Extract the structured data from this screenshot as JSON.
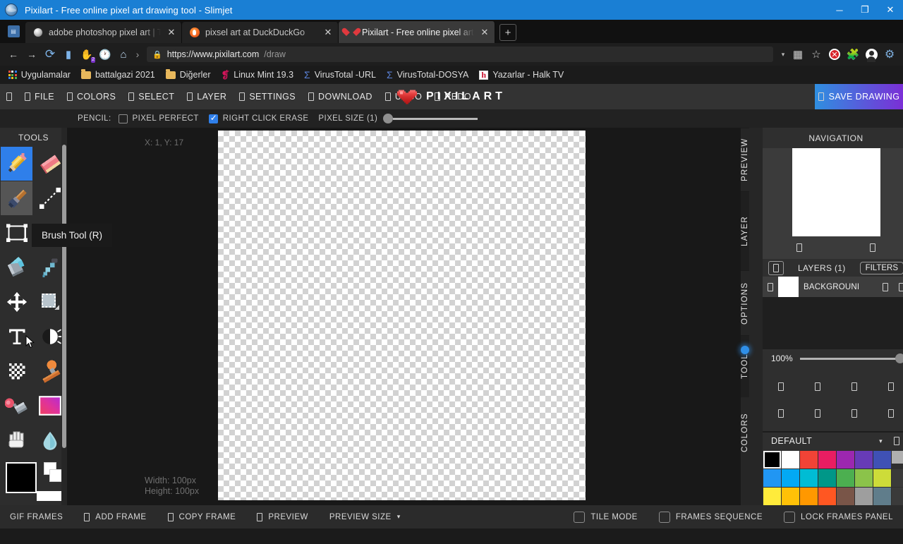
{
  "window": {
    "title": "Pixilart - Free online pixel art drawing tool - Slimjet",
    "minimize": "─",
    "maximize": "❐",
    "close": "✕"
  },
  "tabs": [
    {
      "label": "adobe photoshop pixel art | Tü",
      "close": "✕",
      "icon": "globe-favicon",
      "active": false
    },
    {
      "label": "pixsel art at DuckDuckGo",
      "close": "✕",
      "icon": "duckduckgo-favicon",
      "active": false
    },
    {
      "label": "Pixilart - Free online pixel art dr",
      "close": "✕",
      "icon": "pixilart-heart-favicon",
      "active": true
    }
  ],
  "new_tab_label": "+",
  "navbar": {
    "back": "←",
    "forward": "→",
    "reload": "⟳",
    "reader": "▮",
    "hand": "✋",
    "hand_badge": "2",
    "history": "🕐",
    "home": "⌂",
    "overflow": "›",
    "lock": "🔒",
    "url_host": "https://www.pixilart.com",
    "url_path": "/draw",
    "url_full": "https://www.pixilart.com/draw",
    "dropdown": "▾",
    "apps_grid": "▦",
    "bookmark_star": "☆",
    "ext_adblock": "✕",
    "ext_puzzle": "🧩",
    "ext_profile": "person",
    "ext_settings": "gear"
  },
  "bookmarks": [
    {
      "label": "Uygulamalar",
      "icon": "apps-grid-icon"
    },
    {
      "label": "battalgazi 2021",
      "icon": "folder-icon"
    },
    {
      "label": "Diğerler",
      "icon": "folder-icon"
    },
    {
      "label": "Linux Mint 19.3",
      "icon": "mint-icon"
    },
    {
      "label": "VirusTotal -URL",
      "icon": "sigma-icon"
    },
    {
      "label": "VirusTotal-DOSYA",
      "icon": "sigma-icon"
    },
    {
      "label": "Yazarlar - Halk TV",
      "icon": "halktv-icon"
    }
  ],
  "appbar": {
    "menu": [
      {
        "label": "",
        "icon": "hamburger-icon"
      },
      {
        "label": "FILE",
        "icon": "file-icon"
      },
      {
        "label": "COLORS",
        "icon": "colors-icon"
      },
      {
        "label": "SELECT",
        "icon": "select-icon"
      },
      {
        "label": "LAYER",
        "icon": "layer-icon"
      },
      {
        "label": "SETTINGS",
        "icon": "settings-icon"
      },
      {
        "label": "DOWNLOAD",
        "icon": "download-icon"
      },
      {
        "label": "UNDO",
        "icon": "undo-icon"
      },
      {
        "label": "REDO",
        "icon": "redo-icon"
      }
    ],
    "brand": "PIXILART",
    "save_label": "SAVE DRAWING",
    "save_icon": "save-icon",
    "save_gradient_from": "#2f8fe0",
    "save_gradient_to": "#7b2fd6"
  },
  "options": {
    "tool_label": "PENCIL:",
    "pixel_perfect": {
      "label": "PIXEL PERFECT",
      "checked": false
    },
    "right_click_erase": {
      "label": "RIGHT CLICK ERASE",
      "checked": true
    },
    "pixel_size": {
      "label": "PIXEL SIZE (1)",
      "value": 1
    }
  },
  "tools": {
    "header": "TOOLS",
    "items": [
      {
        "name": "pencil-tool",
        "selected": true
      },
      {
        "name": "eraser-tool",
        "selected": false
      },
      {
        "name": "brush-tool",
        "selected": false,
        "hovered": true
      },
      {
        "name": "line-tool",
        "selected": false
      },
      {
        "name": "rectangle-tool",
        "selected": false
      },
      {
        "name": "circle-tool",
        "selected": false
      },
      {
        "name": "paint-bucket-tool",
        "selected": false
      },
      {
        "name": "eyedropper-tool",
        "selected": false
      },
      {
        "name": "move-tool",
        "selected": false
      },
      {
        "name": "select-rect-tool",
        "selected": false
      },
      {
        "name": "text-tool",
        "selected": false
      },
      {
        "name": "lighten-darken-tool",
        "selected": false
      },
      {
        "name": "dither-tool",
        "selected": false
      },
      {
        "name": "stamp-tool",
        "selected": false
      },
      {
        "name": "spray-tool",
        "selected": false
      },
      {
        "name": "gradient-tool",
        "selected": false
      },
      {
        "name": "hand-tool",
        "selected": false
      },
      {
        "name": "water-tool",
        "selected": false
      },
      {
        "name": "transform-tool",
        "selected": false
      }
    ],
    "tooltip": "Brush Tool (R)",
    "primary_color": "#000000",
    "secondary_color": "#ffffff"
  },
  "canvas": {
    "coords": "X: 1, Y: 17",
    "width_text": "Width: 100px",
    "height_text": "Height: 100px"
  },
  "right_panel": {
    "vtabs": [
      {
        "label": "PREVIEW",
        "active": false
      },
      {
        "label": "LAYER",
        "active": true
      },
      {
        "label": "OPTIONS",
        "active": false
      },
      {
        "label": "TOOL",
        "active": false,
        "indicator": true
      },
      {
        "label": "COLORS",
        "active": false
      }
    ],
    "navigation_header": "NAVIGATION",
    "nav_button_left": "zoom-out-icon",
    "nav_button_right": "zoom-in-icon",
    "layers_title": "LAYERS (1)",
    "layers_add_icon": "add-layer-icon",
    "filters_label": "FILTERS",
    "layer": {
      "name": "BACKGROUNI",
      "visibility_icon": "eye-icon",
      "lock_icon": "lock-icon",
      "menu_icon": "menu-icon"
    },
    "opacity": "100%",
    "opacity_value": 100,
    "icon_rows": [
      [
        "flip-horizontal-icon",
        "flip-vertical-icon",
        "rotate-left-icon",
        "rotate-right-icon"
      ],
      [
        "clear-icon",
        "duplicate-icon",
        "merge-icon",
        "delete-icon"
      ]
    ],
    "palette_name": "DEFAULT",
    "palette_caret": "▾",
    "palette_menu_icon": "palette-menu-icon",
    "palette_colors": [
      "#000000",
      "#ffffff",
      "#f14336",
      "#e91d62",
      "#9c27b0",
      "#673bb7",
      "#3f51b5",
      "#b0b0b0",
      "#2196f3",
      "#03a9f4",
      "#00bcd4",
      "#009788",
      "#4caf50",
      "#8bc34a",
      "#cddc39",
      "#3a3a3a",
      "#ffeb3b",
      "#ffc107",
      "#ff9800",
      "#ff5722",
      "#795548",
      "#9e9e9e",
      "#607d8b",
      "#3a3a3a"
    ]
  },
  "bottom_bar": {
    "gif_frames": "GIF FRAMES",
    "add_frame": "ADD FRAME",
    "copy_frame": "COPY FRAME",
    "preview": "PREVIEW",
    "preview_size": "PREVIEW SIZE",
    "preview_caret": "▾",
    "tile_mode": {
      "label": "TILE MODE",
      "checked": false
    },
    "frames_sequence": {
      "label": "FRAMES SEQUENCE",
      "checked": false
    },
    "lock_frames_panel": {
      "label": "LOCK FRAMES PANEL",
      "checked": false
    }
  }
}
